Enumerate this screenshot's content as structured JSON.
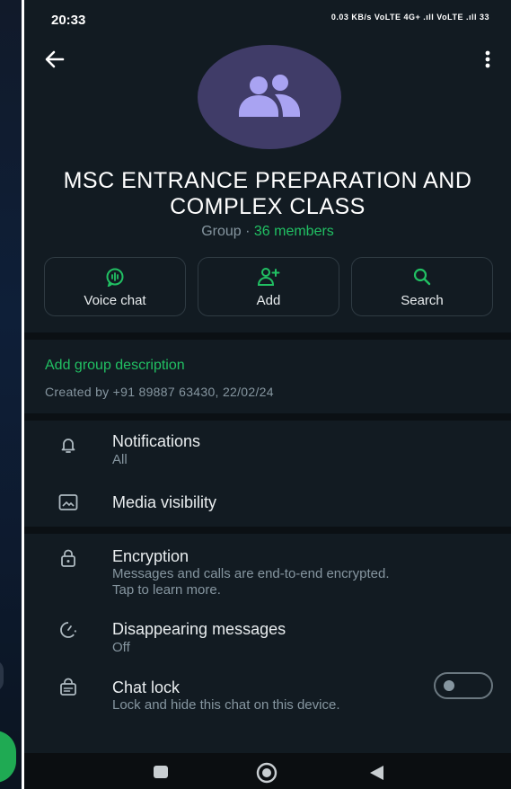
{
  "status_bar": {
    "time": "20:33",
    "indicators": "0.03 KB/s  VoLTE  4G+ .ıll  VoLTE .ıll  33"
  },
  "header": {
    "back_icon": "arrow-left-icon",
    "more_icon": "more-vert-icon",
    "avatar_icon": "group-people-icon",
    "group_name": "MSC ENTRANCE PREPARATION AND COMPLEX  CLASS",
    "group_label": "Group · ",
    "members": "36 members"
  },
  "actions": [
    {
      "label": "Voice chat",
      "icon": "voice-chat-icon"
    },
    {
      "label": "Add",
      "icon": "add-person-icon"
    },
    {
      "label": "Search",
      "icon": "search-icon"
    }
  ],
  "description": {
    "add_label": "Add group description",
    "created": "Created by +91 89887 63430, 22/02/24"
  },
  "settings_1": {
    "notifications": {
      "title": "Notifications",
      "subtitle": "All",
      "icon": "bell-icon"
    },
    "media": {
      "title": "Media visibility",
      "icon": "image-icon"
    }
  },
  "settings_2": {
    "encryption": {
      "title": "Encryption",
      "subtitle": "Messages and calls are end-to-end encrypted. Tap to learn more.",
      "icon": "lock-icon"
    },
    "disappearing": {
      "title": "Disappearing messages",
      "subtitle": "Off",
      "icon": "timer-icon"
    },
    "chat_lock": {
      "title": "Chat lock",
      "subtitle": "Lock and hide this chat on this device.",
      "icon": "chat-lock-icon",
      "enabled": false
    }
  },
  "nav": {
    "recents_icon": "recents-icon",
    "home_icon": "home-icon",
    "back_icon": "back-triangle-icon"
  },
  "colors": {
    "accent": "#21c063",
    "background": "#121b22",
    "avatar": "#403c68",
    "avatar_glyph": "#a9a3f2",
    "secondary_text": "#8696a0"
  }
}
